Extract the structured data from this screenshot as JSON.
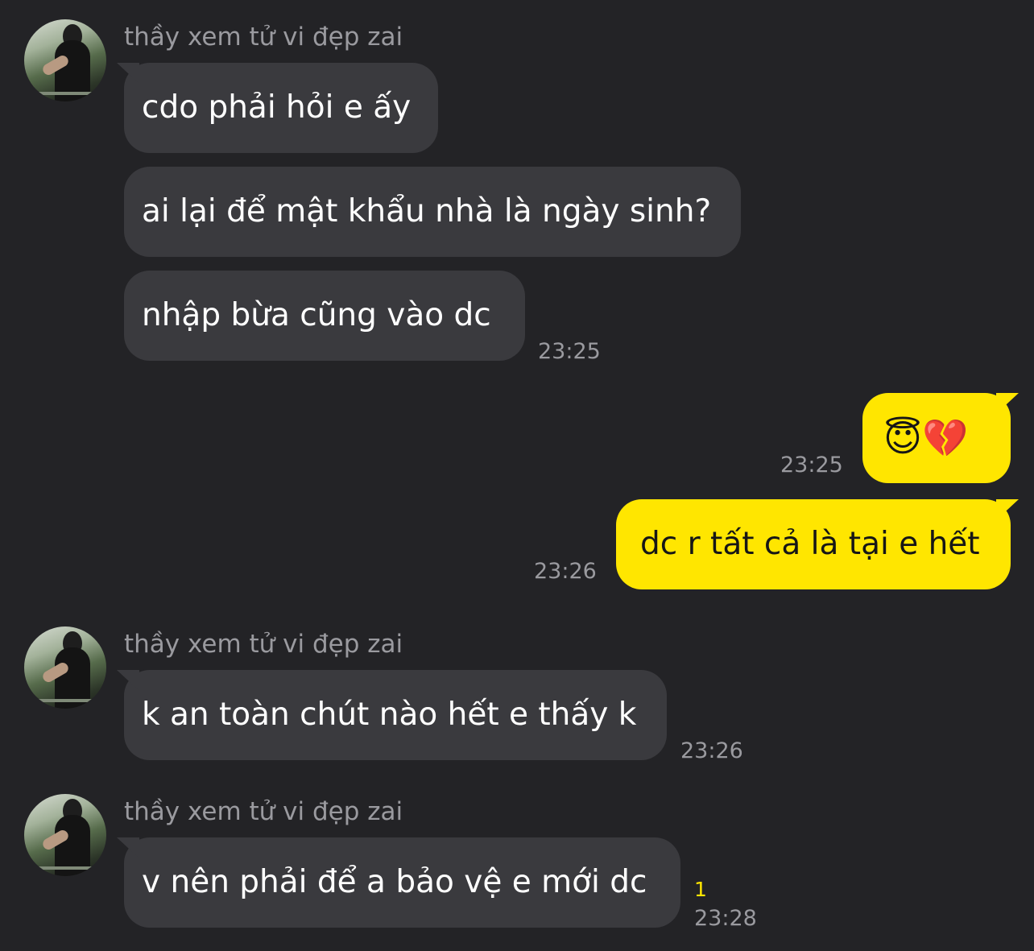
{
  "sender_name": "thầy xem tử vi đẹp zai",
  "messages": [
    {
      "text": "cdo phải hỏi e ấy"
    },
    {
      "text": "ai lại để mật khẩu nhà là ngày sinh?"
    },
    {
      "text": "nhập bừa cũng vào dc",
      "time": "23:25"
    },
    {
      "text": "😇💔",
      "time": "23:25"
    },
    {
      "text": "dc r tất cả là tại e hết",
      "time": "23:26"
    },
    {
      "text": "k an toàn chút nào hết e thấy k",
      "time": "23:26"
    },
    {
      "text": "v nên phải để a bảo vệ e mới dc",
      "time": "23:28",
      "unread": "1"
    }
  ],
  "colors": {
    "background": "#232326",
    "incoming_bubble": "#3a3a3e",
    "outgoing_bubble": "#ffe600",
    "meta_text": "#9a9a9f",
    "unread_count": "#ffe600"
  }
}
